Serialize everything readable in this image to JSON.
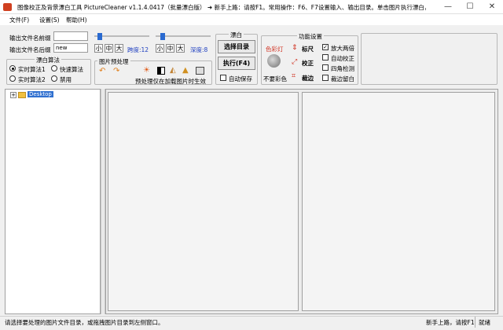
{
  "window": {
    "title": "图像校正及背景漂白工具 PictureCleaner v1.1.4.0417（批量漂白版）   ➜ 新手上路：请按F1。常用操作：F6、F7设置输入、输出目录。单击图片执行漂白，目录名...",
    "minimize": "—",
    "maximize": "☐",
    "close": "✕"
  },
  "menu": {
    "file": "文件(F)",
    "settings": "设置(S)",
    "help": "帮助(H)"
  },
  "output": {
    "prefix_label": "输出文件名前缀",
    "prefix_value": "",
    "suffix_label": "输出文件名后缀",
    "suffix_value": "new"
  },
  "sliders": {
    "small": "小",
    "medium": "中",
    "large": "大",
    "contrast_label": "跨度:12",
    "depth_label": "深度:8"
  },
  "algorithm": {
    "title": "漂白算法",
    "options": [
      "实时算法1",
      "快速算法",
      "实时算法2",
      "禁用"
    ]
  },
  "preprocess": {
    "title": "图片预处理",
    "note": "预处理仅在加载图片时生效"
  },
  "bleach": {
    "title": "漂白",
    "select_dir": "选择目录",
    "execute": "执行(F4)",
    "autosave": "自动保存"
  },
  "features": {
    "title": "功能设置",
    "color_light": "色彩灯",
    "keep_color": "不要彩色",
    "ruler": "标尺",
    "correct": "校正",
    "crop": "裁边",
    "checkboxes": [
      "放大两倍",
      "自动校正",
      "四角检测",
      "裁边留白"
    ],
    "checked": [
      true,
      false,
      false,
      false
    ]
  },
  "tree": {
    "root": "Desktop",
    "expander": "+"
  },
  "status": {
    "message": "请选择要处理的图片文件目录，或拖拽图片目录到左侧窗口。",
    "hint": "新手上路，请按F1",
    "state": "就绪"
  },
  "colors": {
    "accent": "#2a6ad0",
    "icon_red": "#d03020"
  }
}
